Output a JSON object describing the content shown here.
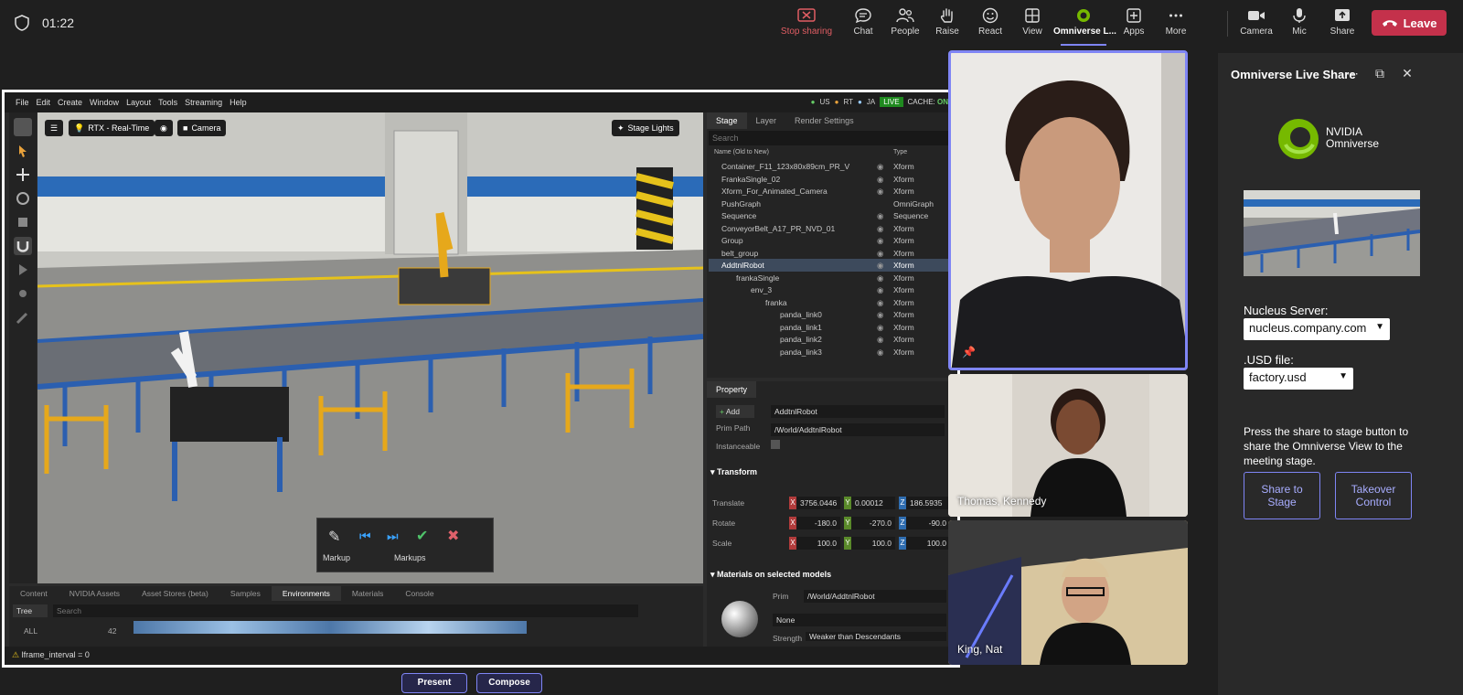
{
  "topbar": {
    "timer": "01:22",
    "buttons": [
      {
        "label": "Stop sharing",
        "icon": "stop-sharing-icon"
      },
      {
        "label": "Chat",
        "icon": "chat-icon"
      },
      {
        "label": "People",
        "icon": "people-icon"
      },
      {
        "label": "Raise",
        "icon": "hand-icon"
      },
      {
        "label": "React",
        "icon": "smiley-icon"
      },
      {
        "label": "View",
        "icon": "grid-icon"
      },
      {
        "label": "Omniverse L...",
        "icon": "omniverse-icon"
      },
      {
        "label": "Apps",
        "icon": "plus-icon"
      },
      {
        "label": "More",
        "icon": "ellipsis-icon"
      },
      {
        "label": "Camera",
        "icon": "camera-icon"
      },
      {
        "label": "Mic",
        "icon": "mic-icon"
      },
      {
        "label": "Share",
        "icon": "share-icon"
      }
    ],
    "leave_label": "Leave",
    "colors": {
      "leave": "#c4314b",
      "accent": "#7f85f5"
    }
  },
  "omniverse": {
    "menu": [
      "File",
      "Edit",
      "Create",
      "Window",
      "Layout",
      "Tools",
      "Streaming",
      "Help"
    ],
    "users": [
      "US",
      "RT",
      "JA"
    ],
    "live_label": "LIVE",
    "cache_label": "CACHE:",
    "cache_state": "ON",
    "viewport": {
      "renderer": "RTX - Real-Time",
      "camera": "Camera",
      "lights": "Stage Lights"
    },
    "markup": {
      "markup_label": "Markup",
      "markups_label": "Markups"
    },
    "stage": {
      "tabs": [
        "Stage",
        "Layer",
        "Render Settings"
      ],
      "search_placeholder": "Search",
      "col_name": "Name (Old to New)",
      "col_type": "Type",
      "rows": [
        {
          "name": "Container_F11_123x80x89cm_PR_V",
          "type": "Xform"
        },
        {
          "name": "FrankaSingle_02",
          "type": "Xform"
        },
        {
          "name": "Xform_For_Animated_Camera",
          "type": "Xform"
        },
        {
          "name": "PushGraph",
          "type": "OmniGraph"
        },
        {
          "name": "Sequence",
          "type": "Sequence"
        },
        {
          "name": "ConveyorBelt_A17_PR_NVD_01",
          "type": "Xform"
        },
        {
          "name": "Group",
          "type": "Xform"
        },
        {
          "name": "belt_group",
          "type": "Xform"
        },
        {
          "name": "AddtnlRobot",
          "type": "Xform"
        },
        {
          "name": "frankaSingle",
          "type": "Xform"
        },
        {
          "name": "env_3",
          "type": "Xform"
        },
        {
          "name": "franka",
          "type": "Xform"
        },
        {
          "name": "panda_link0",
          "type": "Xform"
        },
        {
          "name": "panda_link1",
          "type": "Xform"
        },
        {
          "name": "panda_link2",
          "type": "Xform"
        },
        {
          "name": "panda_link3",
          "type": "Xform"
        }
      ]
    },
    "property": {
      "tab": "Property",
      "add_label": "Add",
      "prim_name": "AddtnlRobot",
      "prim_path_label": "Prim Path",
      "prim_path": "/World/AddtnlRobot",
      "instanceable_label": "Instanceable",
      "transform_label": "Transform",
      "translate_label": "Translate",
      "translate": [
        "3756.0446",
        "0.00012",
        "186.5935"
      ],
      "rotate_label": "Rotate",
      "rotate": [
        "-180.0",
        "-270.0",
        "-90.0"
      ],
      "scale_label": "Scale",
      "scale": [
        "100.0",
        "100.0",
        "100.0"
      ],
      "materials_label": "Materials on selected models",
      "prim_label": "Prim",
      "prim_value": "/World/AddtnlRobot",
      "material": "None",
      "strength_label": "Strength",
      "strength_value": "Weaker than Descendants"
    },
    "bottom": {
      "tabs": [
        "Content",
        "NVIDIA Assets",
        "Asset Stores (beta)",
        "Samples",
        "Environments",
        "Materials",
        "Console"
      ],
      "tree_label": "Tree",
      "search_placeholder": "Search",
      "all_label": "ALL",
      "count": "42"
    },
    "console_text": "lframe_interval = 0"
  },
  "stage_buttons": {
    "present": "Present",
    "compose": "Compose"
  },
  "participants": [
    {
      "name": ""
    },
    {
      "name": "Thomas, Kennedy"
    },
    {
      "name": "King, Nat"
    }
  ],
  "side_panel": {
    "title": "Omniverse Live Share",
    "logo_line1": "NVIDIA",
    "logo_line2": "Omniverse",
    "nucleus_label": "Nucleus Server:",
    "nucleus_value": "nucleus.company.com",
    "usd_label": ".USD file:",
    "usd_value": "factory.usd",
    "description": "Press the share to stage button to share the Omniverse View to the meeting stage.",
    "share_button": "Share to Stage",
    "takeover_button": "Takeover Control"
  }
}
